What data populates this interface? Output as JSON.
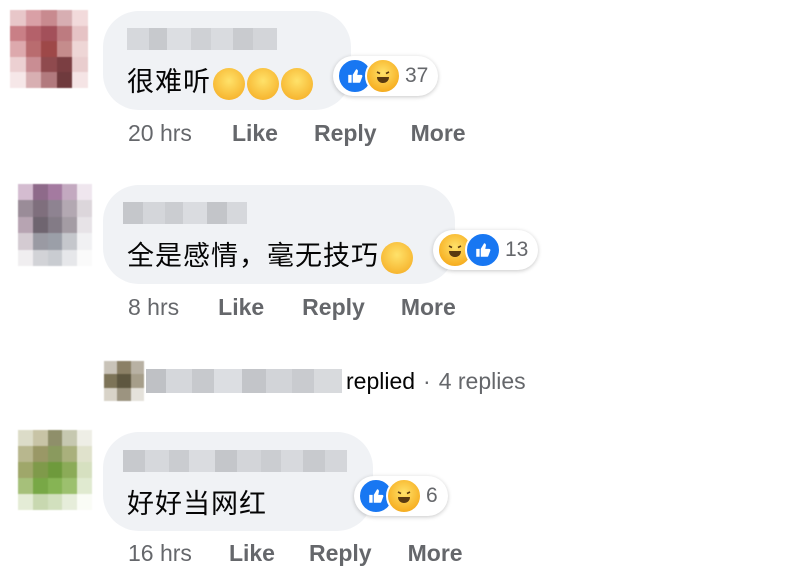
{
  "comments": [
    {
      "text": "很难听",
      "trailing_emojis": [
        "rolling-on-floor-laughing",
        "rolling-on-floor-laughing",
        "rolling-on-floor-laughing"
      ],
      "reaction_types": [
        "like",
        "haha"
      ],
      "reaction_count": "37",
      "time": "20 hrs",
      "like_label": "Like",
      "reply_label": "Reply",
      "more_label": "More"
    },
    {
      "text": "全是感情，毫无技巧",
      "trailing_emojis": [
        "grinning-sweat"
      ],
      "reaction_types": [
        "haha",
        "like"
      ],
      "reaction_count": "13",
      "time": "8 hrs",
      "like_label": "Like",
      "reply_label": "Reply",
      "more_label": "More"
    },
    {
      "text": "好好当网红",
      "trailing_emojis": [],
      "reaction_types": [
        "like",
        "haha"
      ],
      "reaction_count": "6",
      "time": "16 hrs",
      "like_label": "Like",
      "reply_label": "Reply",
      "more_label": "More"
    }
  ],
  "replies_thread": {
    "replied_label": "replied",
    "separator": "·",
    "count_label": "4 replies"
  },
  "colors": {
    "bubble_bg": "#f0f2f5",
    "secondary_text": "#65676b",
    "like_blue": "#1877f2",
    "haha_yellow": "#f7b125"
  }
}
